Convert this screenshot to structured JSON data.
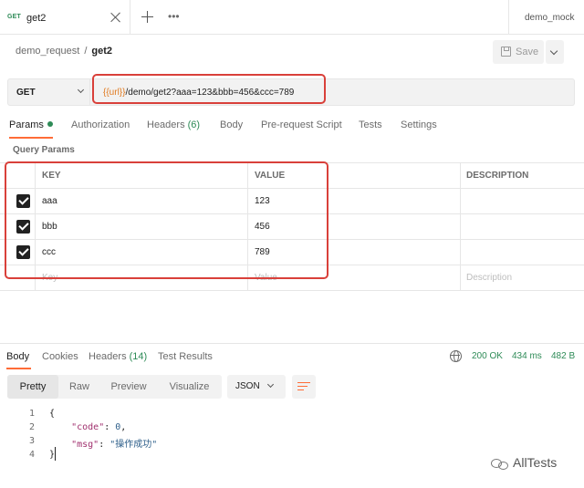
{
  "tab": {
    "method": "GET",
    "title": "get2"
  },
  "environment": "demo_mock",
  "breadcrumb": {
    "collection": "demo_request",
    "separator": "/",
    "request": "get2"
  },
  "toolbar": {
    "save_label": "Save"
  },
  "request": {
    "method": "GET",
    "url_variable": "{{url}}",
    "url_path": "/demo/get2?aaa=123&bbb=456&ccc=789"
  },
  "request_tabs": [
    {
      "label": "Params",
      "active": true
    },
    {
      "label": "Authorization"
    },
    {
      "label": "Headers",
      "count": "(6)"
    },
    {
      "label": "Body"
    },
    {
      "label": "Pre-request Script"
    },
    {
      "label": "Tests"
    },
    {
      "label": "Settings"
    }
  ],
  "query_params": {
    "title": "Query Params",
    "headers": [
      "KEY",
      "VALUE",
      "DESCRIPTION"
    ],
    "rows": [
      {
        "checked": true,
        "key": "aaa",
        "value": "123"
      },
      {
        "checked": true,
        "key": "bbb",
        "value": "456"
      },
      {
        "checked": true,
        "key": "ccc",
        "value": "789"
      }
    ],
    "placeholders": {
      "key": "Key",
      "value": "Value",
      "description": "Description"
    }
  },
  "response_tabs": [
    {
      "label": "Body",
      "active": true
    },
    {
      "label": "Cookies"
    },
    {
      "label": "Headers",
      "count": "(14)"
    },
    {
      "label": "Test Results"
    }
  ],
  "response_meta": {
    "status": "200 OK",
    "time": "434 ms",
    "size": "482 B"
  },
  "view_modes": [
    "Pretty",
    "Raw",
    "Preview",
    "Visualize"
  ],
  "active_view_mode": "Pretty",
  "format": "JSON",
  "response_body": {
    "line_numbers": [
      "1",
      "2",
      "3",
      "4"
    ],
    "lines": {
      "open": "{",
      "code_key": "\"code\"",
      "code_val": "0",
      "msg_key": "\"msg\"",
      "msg_val": "\"操作成功\"",
      "close": "}"
    }
  },
  "watermark": "AllTests",
  "colors": {
    "accent": "#ff6c37",
    "highlight_box": "#d9403a",
    "success": "#2e8b57",
    "variable": "#e07a1f"
  }
}
